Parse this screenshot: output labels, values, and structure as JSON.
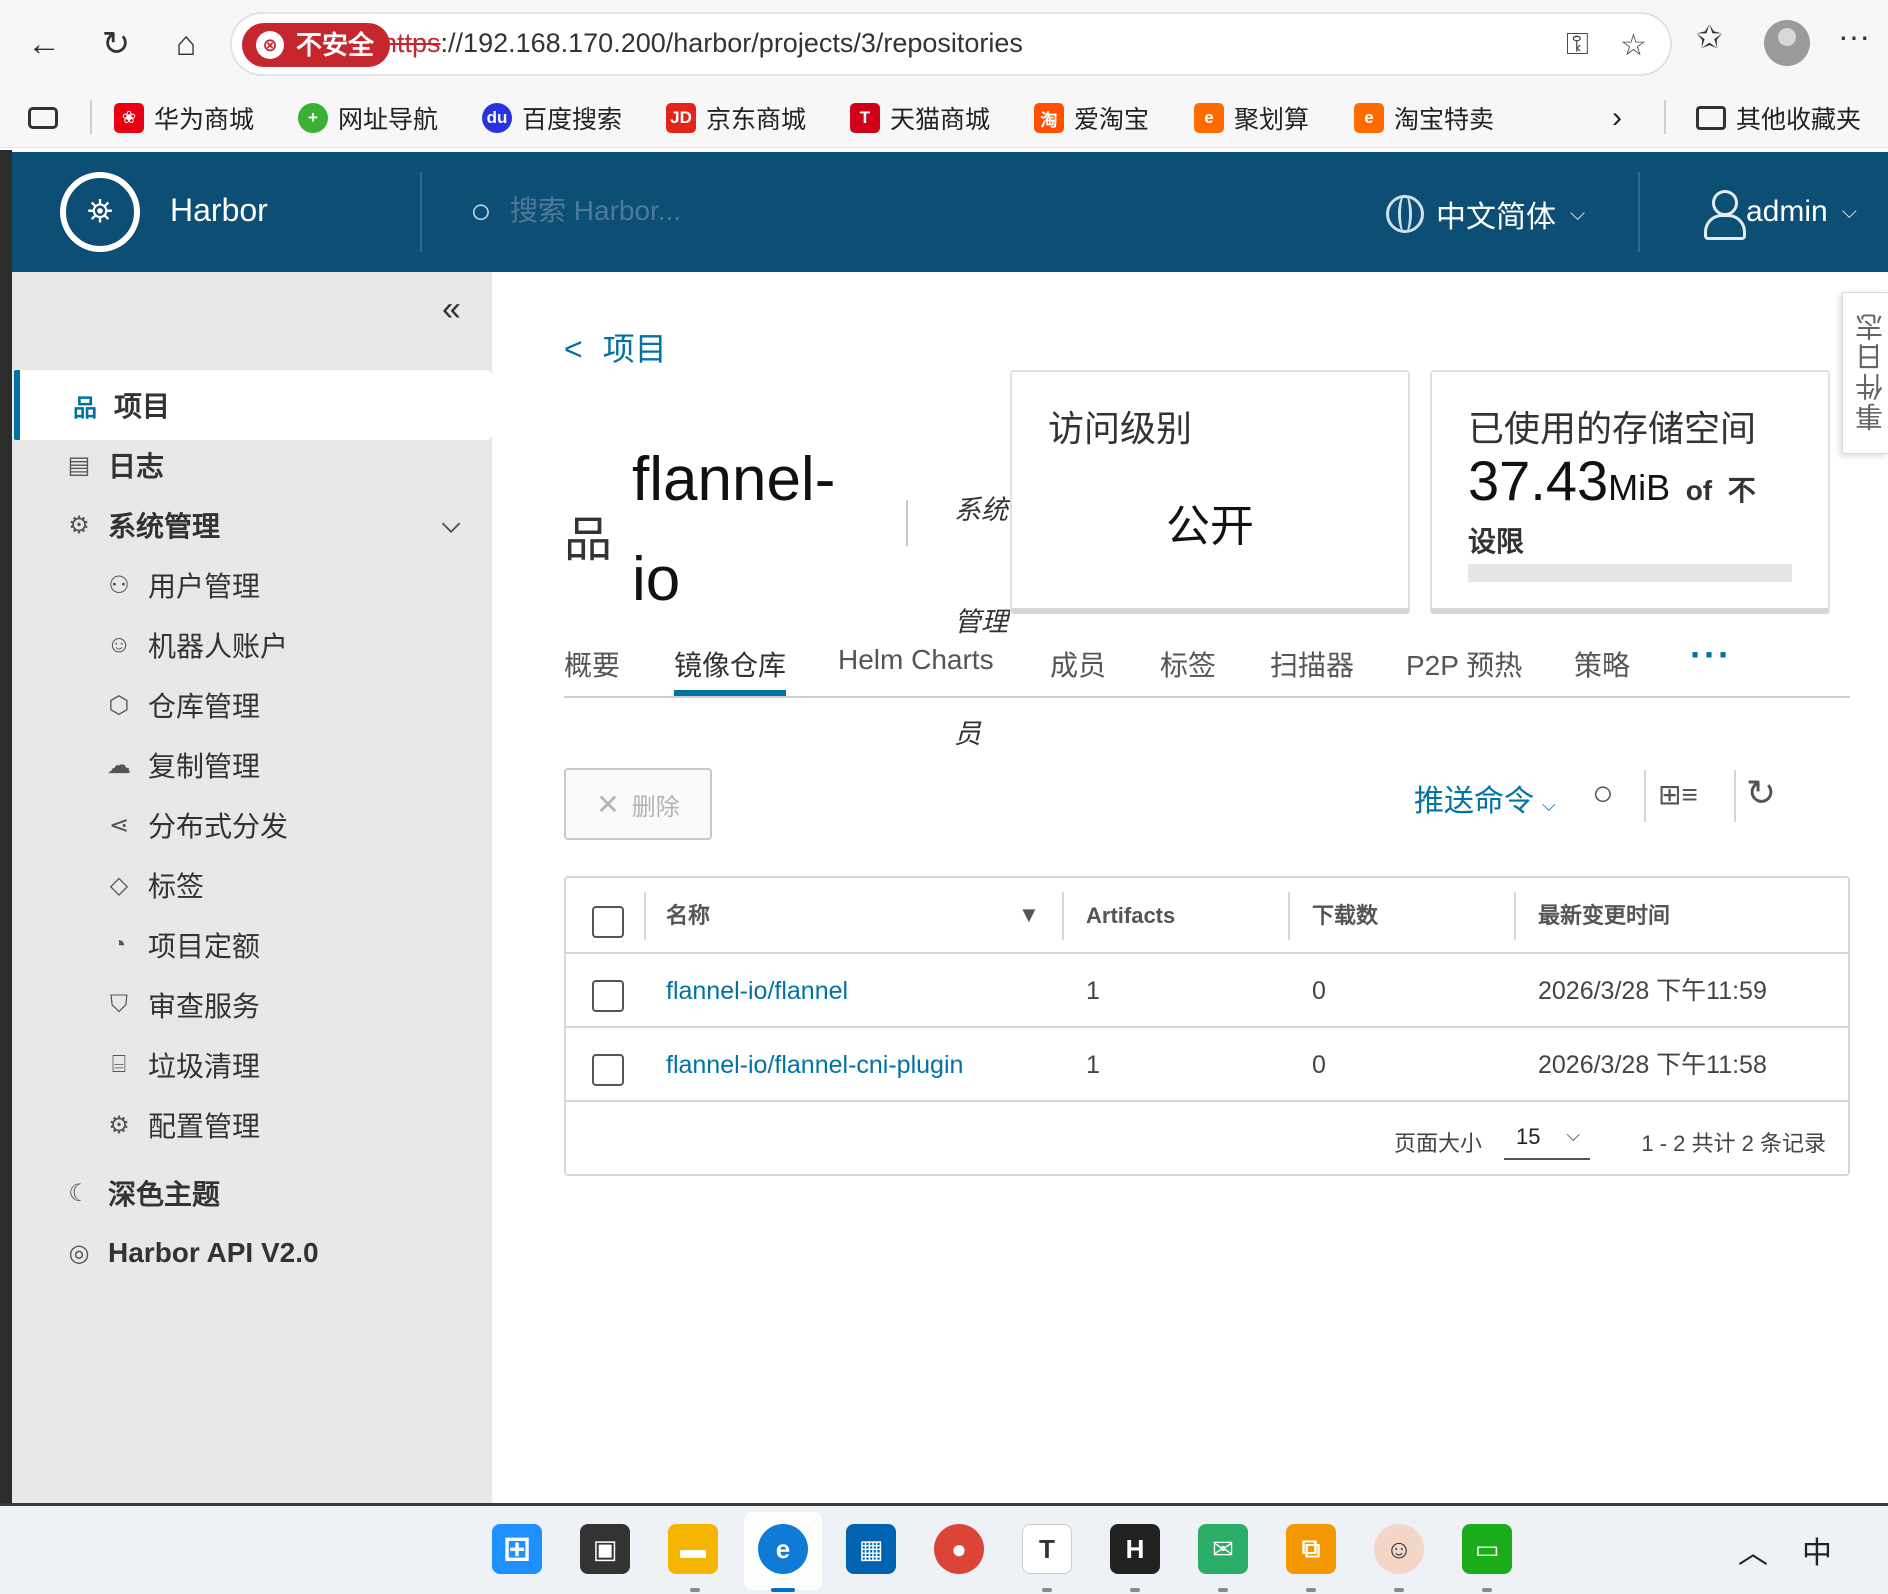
{
  "browser": {
    "security_label": "不安全",
    "url_scheme": "https",
    "url_rest": "://192.168.170.200/harbor/projects/3/repositories",
    "bookmarks": [
      {
        "label": "华为商城",
        "icon": "huawei-icon",
        "color": "#e60012"
      },
      {
        "label": "网址导航",
        "icon": "hao-icon",
        "color": "#3cb034"
      },
      {
        "label": "百度搜索",
        "icon": "baidu-icon",
        "color": "#2932e1"
      },
      {
        "label": "京东商城",
        "icon": "jd-icon",
        "color": "#e1251b"
      },
      {
        "label": "天猫商城",
        "icon": "tmall-icon",
        "color": "#d0021b"
      },
      {
        "label": "爱淘宝",
        "icon": "taobao-icon",
        "color": "#ff5000"
      },
      {
        "label": "聚划算",
        "icon": "juhuasuan-icon",
        "color": "#ff6a00"
      },
      {
        "label": "淘宝特卖",
        "icon": "taobao-sale-icon",
        "color": "#ff6a00"
      }
    ],
    "other_bookmarks": "其他收藏夹"
  },
  "header": {
    "brand": "Harbor",
    "search_placeholder": "搜索 Harbor...",
    "language": "中文简体",
    "user": "admin"
  },
  "sidebar": {
    "items": [
      {
        "label": "项目",
        "icon": "projects-icon"
      },
      {
        "label": "日志",
        "icon": "logs-icon"
      },
      {
        "label": "系统管理",
        "icon": "admin-icon"
      },
      {
        "label": "用户管理",
        "icon": "users-icon"
      },
      {
        "label": "机器人账户",
        "icon": "robot-icon"
      },
      {
        "label": "仓库管理",
        "icon": "registry-icon"
      },
      {
        "label": "复制管理",
        "icon": "replication-icon"
      },
      {
        "label": "分布式分发",
        "icon": "distribution-icon"
      },
      {
        "label": "标签",
        "icon": "tag-icon"
      },
      {
        "label": "项目定额",
        "icon": "quota-icon"
      },
      {
        "label": "审查服务",
        "icon": "shield-icon"
      },
      {
        "label": "垃圾清理",
        "icon": "trash-icon"
      },
      {
        "label": "配置管理",
        "icon": "gear-icon"
      },
      {
        "label": "深色主题",
        "icon": "moon-icon"
      },
      {
        "label": "Harbor API V2.0",
        "icon": "api-icon"
      }
    ]
  },
  "project": {
    "back_label": "项目",
    "name": "flannel-io",
    "role": "系统管理员",
    "access_title": "访问级别",
    "access_value": "公开",
    "storage_title": "已使用的存储空间",
    "storage_value": "37.43",
    "storage_unit": "MiB",
    "storage_of": "of",
    "storage_limit": "不设限",
    "storage_fraction": 0,
    "event_log": "事件日志"
  },
  "tabs": [
    "概要",
    "镜像仓库",
    "Helm Charts",
    "成员",
    "标签",
    "扫描器",
    "P2P 预热",
    "策略"
  ],
  "toolbar": {
    "delete_label": "删除",
    "push_command": "推送命令"
  },
  "table": {
    "columns": [
      "名称",
      "Artifacts",
      "下载数",
      "最新变更时间"
    ],
    "rows": [
      {
        "name": "flannel-io/flannel",
        "artifacts": "1",
        "pulls": "0",
        "updated": "2026/3/28 下午11:59"
      },
      {
        "name": "flannel-io/flannel-cni-plugin",
        "artifacts": "1",
        "pulls": "0",
        "updated": "2026/3/28 下午11:58"
      }
    ],
    "page_size_label": "页面大小",
    "page_size": "15",
    "page_info": "1 - 2 共计 2 条记录"
  },
  "taskbar": {
    "tray_ime": "中"
  }
}
